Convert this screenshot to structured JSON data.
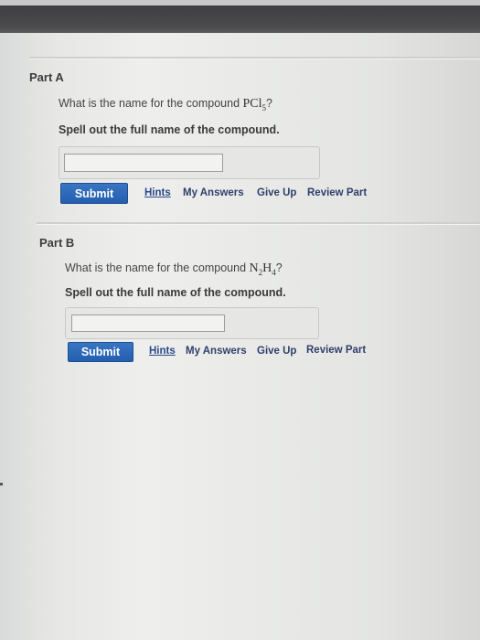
{
  "part_a": {
    "title": "Part A",
    "question_prefix": "What is the name for the compound ",
    "formula_parts": [
      {
        "text": "PCl",
        "sub": "5"
      }
    ],
    "question_suffix": "?",
    "instruction": "Spell out the full name of the compound.",
    "answer_value": "",
    "submit_label": "Submit",
    "hints_label": "Hints",
    "my_answers_label": "My Answers",
    "give_up_label": "Give Up",
    "review_part_label": "Review Part"
  },
  "part_b": {
    "title": "Part B",
    "question_prefix": "What is the name for the compound ",
    "formula_parts": [
      {
        "text": "N",
        "sub": "2"
      },
      {
        "text": "H",
        "sub": "4"
      }
    ],
    "question_suffix": "?",
    "instruction": "Spell out the full name of the compound.",
    "answer_value": "",
    "submit_label": "Submit",
    "hints_label": "Hints",
    "my_answers_label": "My Answers",
    "give_up_label": "Give Up",
    "review_part_label": "Review Part"
  },
  "colors": {
    "submit_button": "#2b66b6",
    "link": "#2f3f6a"
  }
}
